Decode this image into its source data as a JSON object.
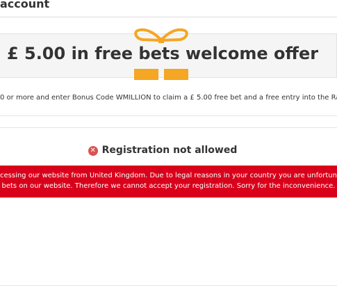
{
  "header": {
    "title": "account"
  },
  "offer": {
    "title": "£ 5.00 in free bets welcome offer",
    "bonus_text": "0 or more and enter Bonus Code WMILLION to claim a £ 5.00 free bet and a free entry into the Race",
    "icon": "gift-icon",
    "accent_color": "#f5a623"
  },
  "registration": {
    "status_text": "Registration not allowed",
    "icon": "error-x-icon",
    "alert_color": "#d9001b",
    "message_line1": "cessing our website from United Kingdom. Due to legal reasons in your country you are unfortunatel",
    "message_line2": "bets on our website. Therefore we cannot accept your registration. Sorry for the inconvenience."
  }
}
